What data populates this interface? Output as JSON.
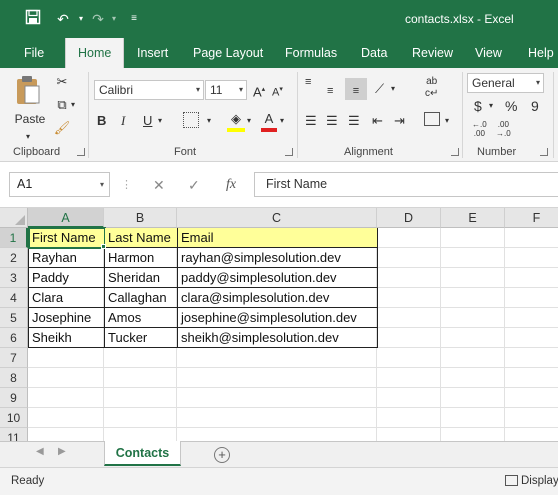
{
  "window": {
    "title": "contacts.xlsx  -  Excel"
  },
  "qat": {
    "save_icon": "save-icon",
    "undo_icon": "undo-icon",
    "redo_icon": "redo-icon",
    "customize_icon": "customize-qat-icon"
  },
  "ribbon_tabs": [
    {
      "label": "File"
    },
    {
      "label": "Home"
    },
    {
      "label": "Insert"
    },
    {
      "label": "Page Layout"
    },
    {
      "label": "Formulas"
    },
    {
      "label": "Data"
    },
    {
      "label": "Review"
    },
    {
      "label": "View"
    },
    {
      "label": "Help"
    }
  ],
  "ribbon": {
    "clipboard": {
      "label": "Clipboard",
      "paste_label": "Paste"
    },
    "font": {
      "label": "Font",
      "font_name": "Calibri",
      "font_size": "11",
      "bold": "B",
      "italic": "I",
      "underline": "U"
    },
    "alignment": {
      "label": "Alignment"
    },
    "number": {
      "label": "Number",
      "format": "General",
      "currency": "$",
      "percent": "%",
      "comma": "9"
    }
  },
  "formula_bar": {
    "name_box": "A1",
    "cancel": "✕",
    "enter": "✓",
    "fx": "fx",
    "content": "First Name"
  },
  "grid": {
    "columns": [
      "A",
      "B",
      "C",
      "D",
      "E",
      "F"
    ],
    "rows": [
      "1",
      "2",
      "3",
      "4",
      "5",
      "6",
      "7",
      "8",
      "9",
      "10",
      "11"
    ],
    "data": [
      [
        "First Name",
        "Last Name",
        "Email"
      ],
      [
        "Rayhan",
        "Harmon",
        "rayhan@simplesolution.dev"
      ],
      [
        "Paddy",
        "Sheridan",
        "paddy@simplesolution.dev"
      ],
      [
        "Clara",
        "Callaghan",
        "clara@simplesolution.dev"
      ],
      [
        "Josephine",
        "Amos",
        "josephine@simplesolution.dev"
      ],
      [
        "Sheikh",
        "Tucker",
        "sheikh@simplesolution.dev"
      ]
    ],
    "header_fill": "#ffff99",
    "active_cell": "A1"
  },
  "sheets": {
    "active": "Contacts",
    "add_icon": "add-sheet-icon"
  },
  "status": {
    "text": "Ready",
    "display_settings": "Display"
  },
  "colors": {
    "brand": "#217346"
  }
}
